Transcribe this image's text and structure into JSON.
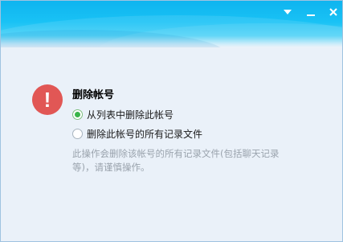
{
  "titlebar": {
    "menu_icon": "dropdown-triangle-icon",
    "minimize_icon": "minimize-icon",
    "close_icon": "close-icon"
  },
  "dialog": {
    "alert_icon": "exclamation-alert-icon",
    "alert_color": "#e15755",
    "title": "删除帐号",
    "options": [
      {
        "label": "从列表中删除此帐号",
        "checked": true
      },
      {
        "label": "删除此帐号的所有记录文件",
        "checked": false
      }
    ],
    "hint": "此操作会删除该帐号的所有记录文件(包括聊天记录等)，请谨慎操作。"
  },
  "colors": {
    "title_bar": "#19c2f5",
    "background": "#eaf1f9",
    "radio_selected": "#3ab54a",
    "hint_text": "#9aa3ad"
  }
}
